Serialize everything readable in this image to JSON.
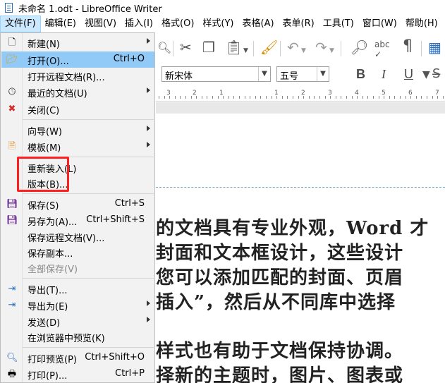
{
  "window": {
    "title": "未命名 1.odt - LibreOffice Writer"
  },
  "menubar": [
    "文件(F)",
    "编辑(E)",
    "视图(V)",
    "插入(I)",
    "格式(O)",
    "样式(Y)",
    "表格(A)",
    "表单(R)",
    "工具(T)",
    "窗口(W)",
    "帮助(H)"
  ],
  "toolbar": {
    "font_name": "新宋体",
    "font_size": "五号",
    "bold": "B",
    "italic": "I",
    "underline": "U"
  },
  "ruler_numbers": [
    "3",
    "2",
    "1",
    "1",
    "2",
    "3",
    "4",
    "5",
    "6",
    "7"
  ],
  "file_menu": {
    "new": "新建(N)",
    "open": "打开(O)...",
    "open_shortcut": "Ctrl+O",
    "open_remote": "打开远程文档(R)...",
    "recent": "最近的文档(U)",
    "close": "关闭(C)",
    "wizard": "向导(W)",
    "templates": "模板(M)",
    "reload": "重新装入(L)",
    "versions": "版本(B)...",
    "save": "保存(S)",
    "save_shortcut": "Ctrl+S",
    "save_as": "另存为(A)...",
    "save_as_shortcut": "Ctrl+Shift+S",
    "save_remote": "保存远程文档(V)...",
    "save_copy": "保存副本...",
    "save_all": "全部保存(V)",
    "export": "导出(T)...",
    "export_as": "导出为(E)",
    "send": "发送(D)",
    "preview_browser": "在浏览器中预览(K)",
    "print_preview": "打印预览(P)",
    "print_preview_shortcut": "Ctrl+Shift+O",
    "print": "打印(P)...",
    "print_shortcut": "Ctrl+P"
  },
  "document": {
    "lines": [
      "的文档具有专业外观，Word 才",
      "封面和文本框设计，这些设计",
      "您可以添加匹配的封面、页眉",
      "插入”，然后从不同库中选择",
      "样式也有助于文档保持协调。",
      "择新的主题时，图片、图表或"
    ]
  },
  "colors": {
    "menu_highlight": "#91c9f7",
    "menubar_active": "#cce8ff",
    "annotation_box": "#ff1f1f"
  }
}
